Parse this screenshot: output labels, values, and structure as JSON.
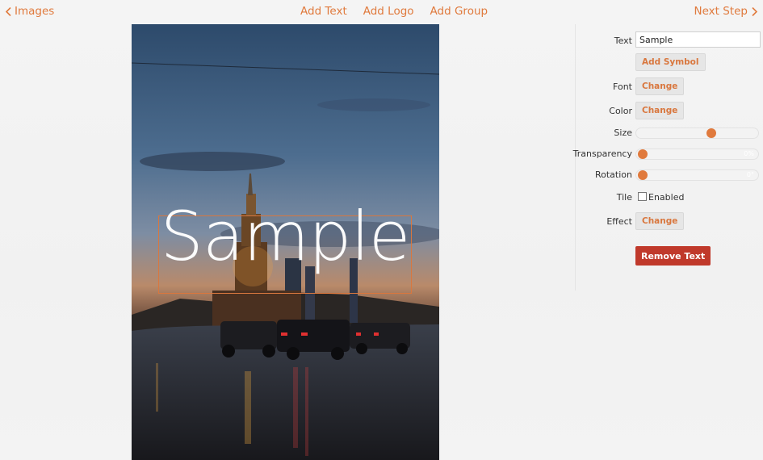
{
  "nav": {
    "back_label": "Images",
    "next_label": "Next Step",
    "links": [
      "Add Text",
      "Add Logo",
      "Add Group"
    ]
  },
  "canvas": {
    "overlay_text": "Sample"
  },
  "panel": {
    "text_label": "Text",
    "text_value": "Sample",
    "add_symbol": "Add Symbol",
    "font_label": "Font",
    "font_button": "Change",
    "color_label": "Color",
    "color_button": "Change",
    "size_label": "Size",
    "size_level": 0.62,
    "transparency_label": "Transparency",
    "transparency_value": "0%",
    "transparency_level": 0,
    "rotation_label": "Rotation",
    "rotation_value": "0°",
    "rotation_level": 0,
    "tile_label": "Tile",
    "tile_option": "Enabled",
    "tile_checked": false,
    "effect_label": "Effect",
    "effect_button": "Change",
    "remove_button": "Remove Text"
  },
  "colors": {
    "accent": "#e07a3d",
    "danger": "#c0392b",
    "button_bg": "#e6e6e6"
  }
}
